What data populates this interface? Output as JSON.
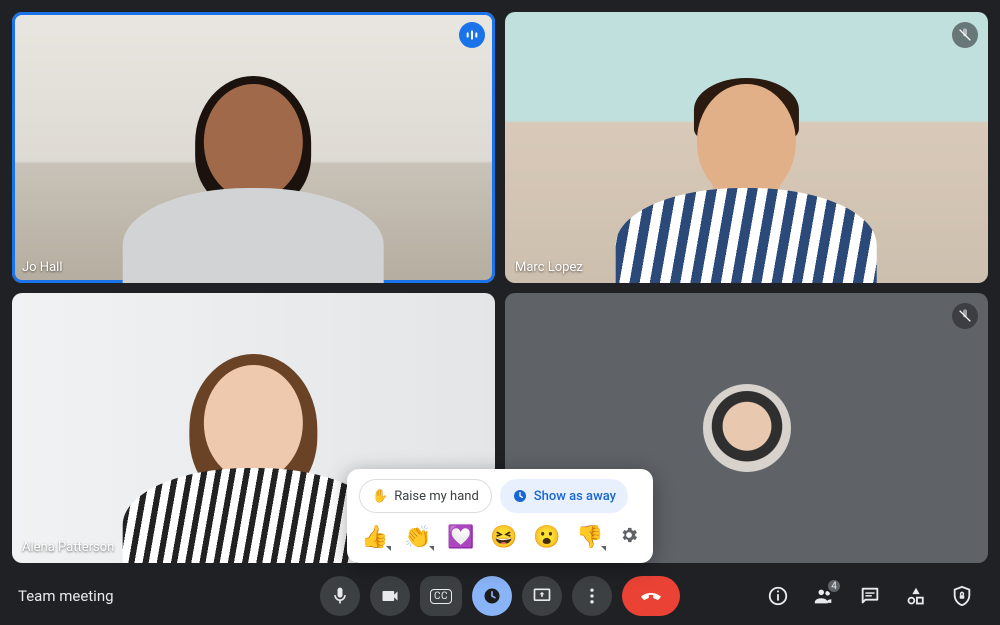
{
  "meeting": {
    "title": "Team meeting"
  },
  "tiles": [
    {
      "name": "Jo Hall",
      "speaking": true,
      "muted": false,
      "camera_off": false
    },
    {
      "name": "Marc Lopez",
      "speaking": false,
      "muted": true,
      "camera_off": false
    },
    {
      "name": "Alena Patterson",
      "speaking": false,
      "muted": false,
      "camera_off": false
    },
    {
      "name": "",
      "speaking": false,
      "muted": true,
      "camera_off": true
    }
  ],
  "popup": {
    "raise_hand_label": "Raise my hand",
    "show_away_label": "Show as away",
    "reactions": [
      "thumbs-up",
      "clap",
      "heart",
      "laugh",
      "surprised",
      "thumbs-down"
    ],
    "reaction_glyphs": [
      "👍",
      "👏",
      "💟",
      "😆",
      "😮",
      "👎"
    ]
  },
  "controls": {
    "mic": "microphone",
    "camera": "camera",
    "captions": "CC",
    "reactions": "reactions",
    "present": "present-screen",
    "more": "more-options",
    "leave": "leave-call"
  },
  "right_panel": {
    "info": "meeting-details",
    "people": "people",
    "people_count": "4",
    "chat": "chat",
    "activities": "activities",
    "host": "host-controls"
  },
  "colors": {
    "bg": "#202124",
    "tile": "#3c4043",
    "tile_off": "#5f6368",
    "primary": "#1a73e8",
    "primary_light": "#8ab4f8",
    "away_chip_bg": "#e8f0fe",
    "away_chip_fg": "#1967d2",
    "end_call": "#ea4335"
  }
}
